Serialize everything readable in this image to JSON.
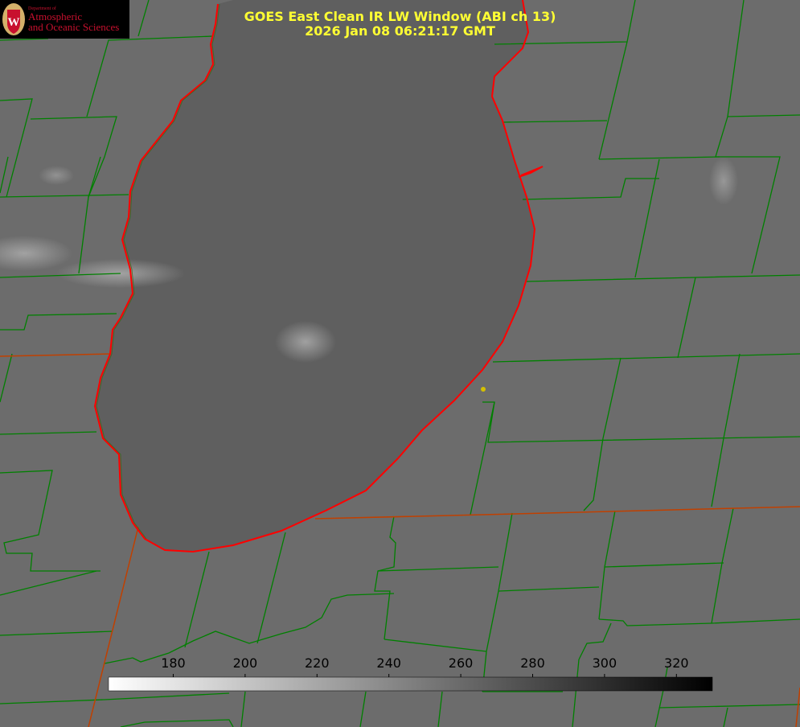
{
  "logo": {
    "department_text": "Department of",
    "line1": "Atmospheric",
    "line2": "and Oceanic Sciences",
    "seal_letter": "W",
    "seal_color": "#c8102e"
  },
  "title": {
    "line1": "GOES East Clean IR LW Window (ABI ch 13)",
    "line2": "2026 Jan 08 06:21:17 GMT"
  },
  "colorbar": {
    "ticks": [
      "180",
      "200",
      "220",
      "240",
      "260",
      "280",
      "300",
      "320"
    ],
    "min_value": 162,
    "max_value": 330,
    "gradient_from": "#ffffff",
    "gradient_to": "#000000"
  },
  "colors": {
    "background": "#6c6c6c",
    "lake": "#5f5f5f",
    "cloud": "#a0a0a0",
    "county_lines": "#008000",
    "shoreline": "#ff0000",
    "state_lines": "#c04000",
    "title_text": "#ffff33",
    "marker": "#d4c000"
  },
  "map": {
    "water_body": "lake",
    "marker": "city-marker"
  }
}
